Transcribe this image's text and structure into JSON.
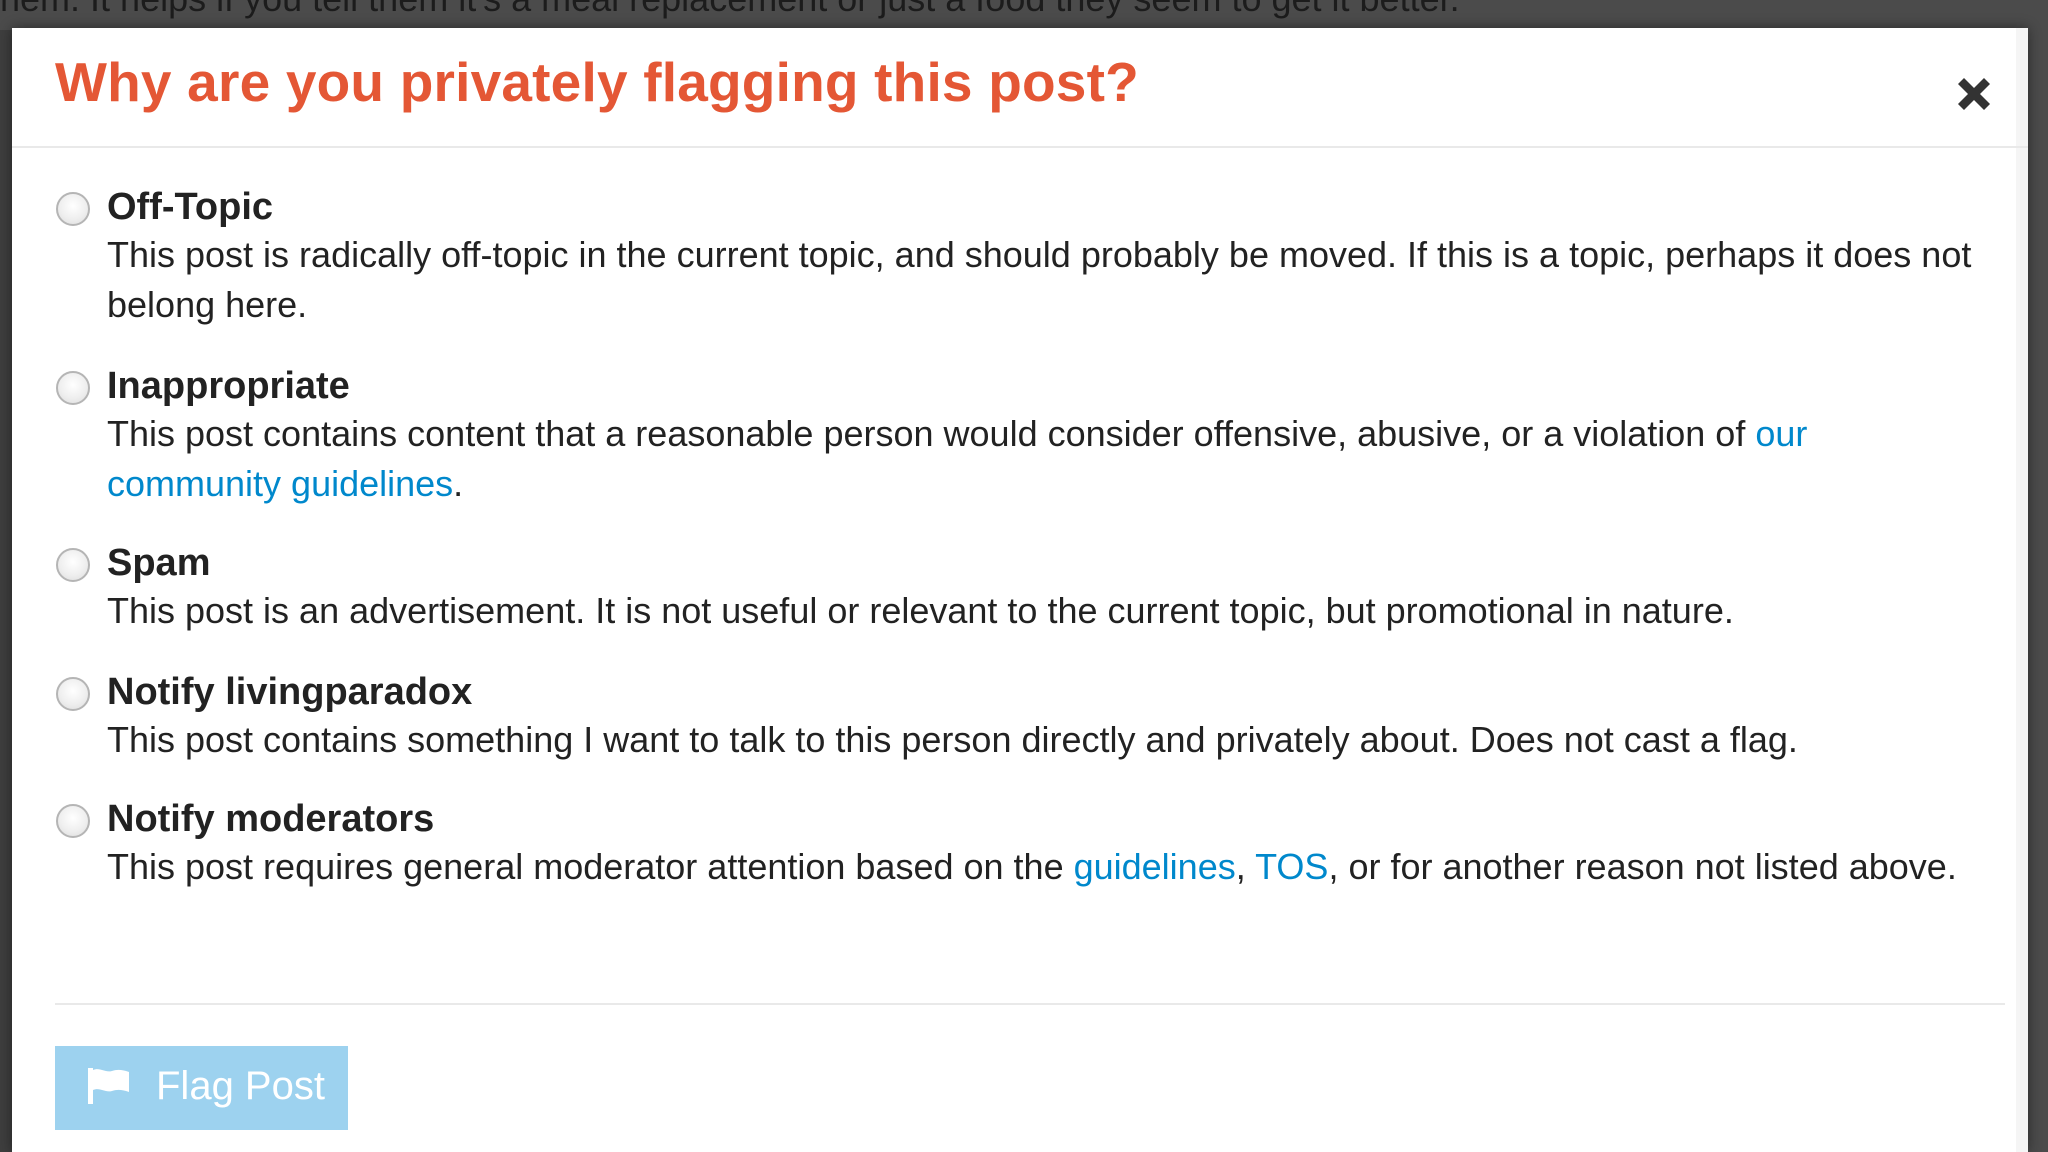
{
  "background": {
    "text": "hem. It helps if you tell them it's a meal replacement or just a food they seem to get it better."
  },
  "modal": {
    "title": "Why are you privately flagging this post?",
    "close_icon": "close-icon"
  },
  "options": [
    {
      "label": "Off-Topic",
      "description": "This post is radically off-topic in the current topic, and should probably be moved. If this is a topic, perhaps it does not belong here."
    },
    {
      "label": "Inappropriate",
      "description_before": "This post contains content that a reasonable person would consider offensive, abusive, or a violation of ",
      "link": "our community guidelines",
      "description_after": "."
    },
    {
      "label": "Spam",
      "description": "This post is an advertisement. It is not useful or relevant to the current topic, but promotional in nature."
    },
    {
      "label": "Notify livingparadox",
      "description": "This post contains something I want to talk to this person directly and privately about. Does not cast a flag."
    },
    {
      "label": "Notify moderators",
      "description_before": "This post requires general moderator attention based on the ",
      "link1": "guidelines",
      "separator": ", ",
      "link2": "TOS",
      "description_after": ", or for another reason not listed above."
    }
  ],
  "footer": {
    "flag_button_label": "Flag Post",
    "flag_icon": "flag-icon"
  },
  "colors": {
    "title": "#e45735",
    "link": "#0088cc",
    "button_disabled": "#9dd2ef"
  }
}
